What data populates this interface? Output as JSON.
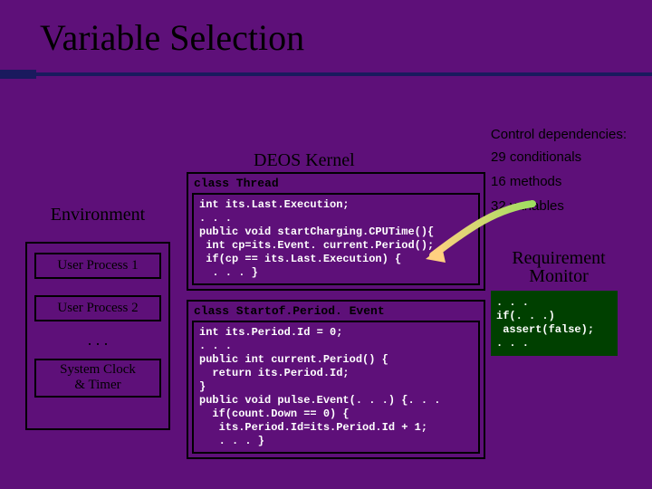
{
  "title": "Variable Selection",
  "control_label": "Control dependencies:",
  "kernel_header": "DEOS Kernel",
  "stats": {
    "conditionals": "29 conditionals",
    "methods": "16 methods",
    "variables": "32 variables"
  },
  "requirement": {
    "label1": "Requirement",
    "label2": "Monitor",
    "code": ". . .\nif(. . .)\n assert(false);\n. . ."
  },
  "environment": {
    "title": "Environment",
    "proc1": "User Process 1",
    "proc2": "User Process 2",
    "ellipsis": ". . .",
    "clock_l1": "System Clock",
    "clock_l2": "& Timer"
  },
  "kernel": {
    "class1": "class Thread",
    "code1": "int its.Last.Execution;\n. . .\npublic void startCharging.CPUTime(){\n int cp=its.Event. current.Period();\n if(cp == its.Last.Execution) {\n  . . . }",
    "class2": "class Startof.Period. Event",
    "code2": "int its.Period.Id = 0;\n. . .\npublic int current.Period() {\n  return its.Period.Id;\n}\npublic void pulse.Event(. . .) {. . .\n  if(count.Down == 0) {\n   its.Period.Id=its.Period.Id + 1;\n   . . . }"
  }
}
